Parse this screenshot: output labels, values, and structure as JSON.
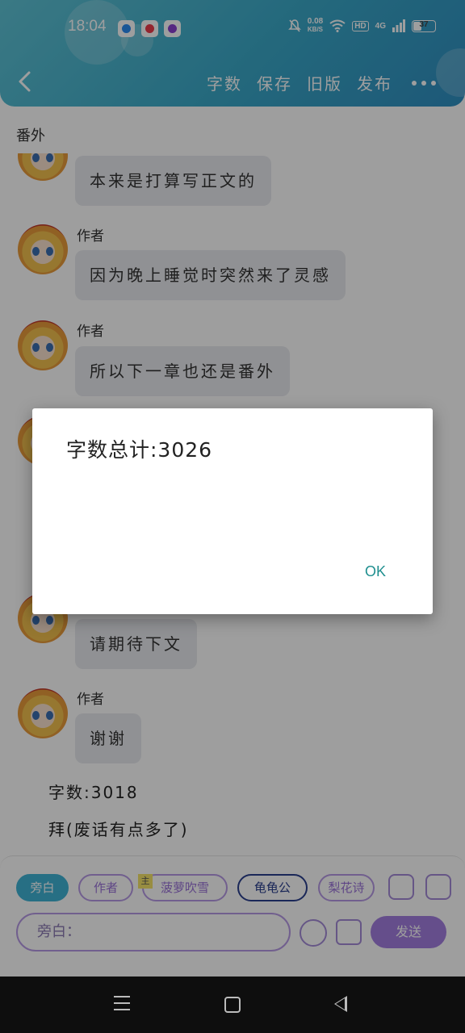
{
  "status_bar": {
    "time": "18:04",
    "net_speed_value": "0.08",
    "net_speed_unit": "KB/S",
    "hd_badge": "HD",
    "network": "4G",
    "battery": "37"
  },
  "toolbar": {
    "word_count_label": "字数",
    "save_label": "保存",
    "old_version_label": "旧版",
    "publish_label": "发布"
  },
  "chat": {
    "title": "番外",
    "messages": [
      {
        "author": "",
        "text": "本来是打算写正文的"
      },
      {
        "author": "作者",
        "text": "因为晚上睡觉时突然来了灵感"
      },
      {
        "author": "作者",
        "text": "所以下一章也还是番外"
      },
      {
        "author": "",
        "text": "请期待下文"
      },
      {
        "author": "作者",
        "text": "谢谢"
      }
    ],
    "footer_word_count": "字数:3018",
    "footer_note": "拜(废话有点多了)"
  },
  "input_bar": {
    "roles": [
      "旁白",
      "作者",
      "菠萝吹雪",
      "龟龟公",
      "梨花诗"
    ],
    "crown_mark": "主",
    "input_placeholder": "旁白：",
    "send_label": "发送"
  },
  "dialog": {
    "message": "字数总计:3026",
    "ok_label": "OK"
  }
}
